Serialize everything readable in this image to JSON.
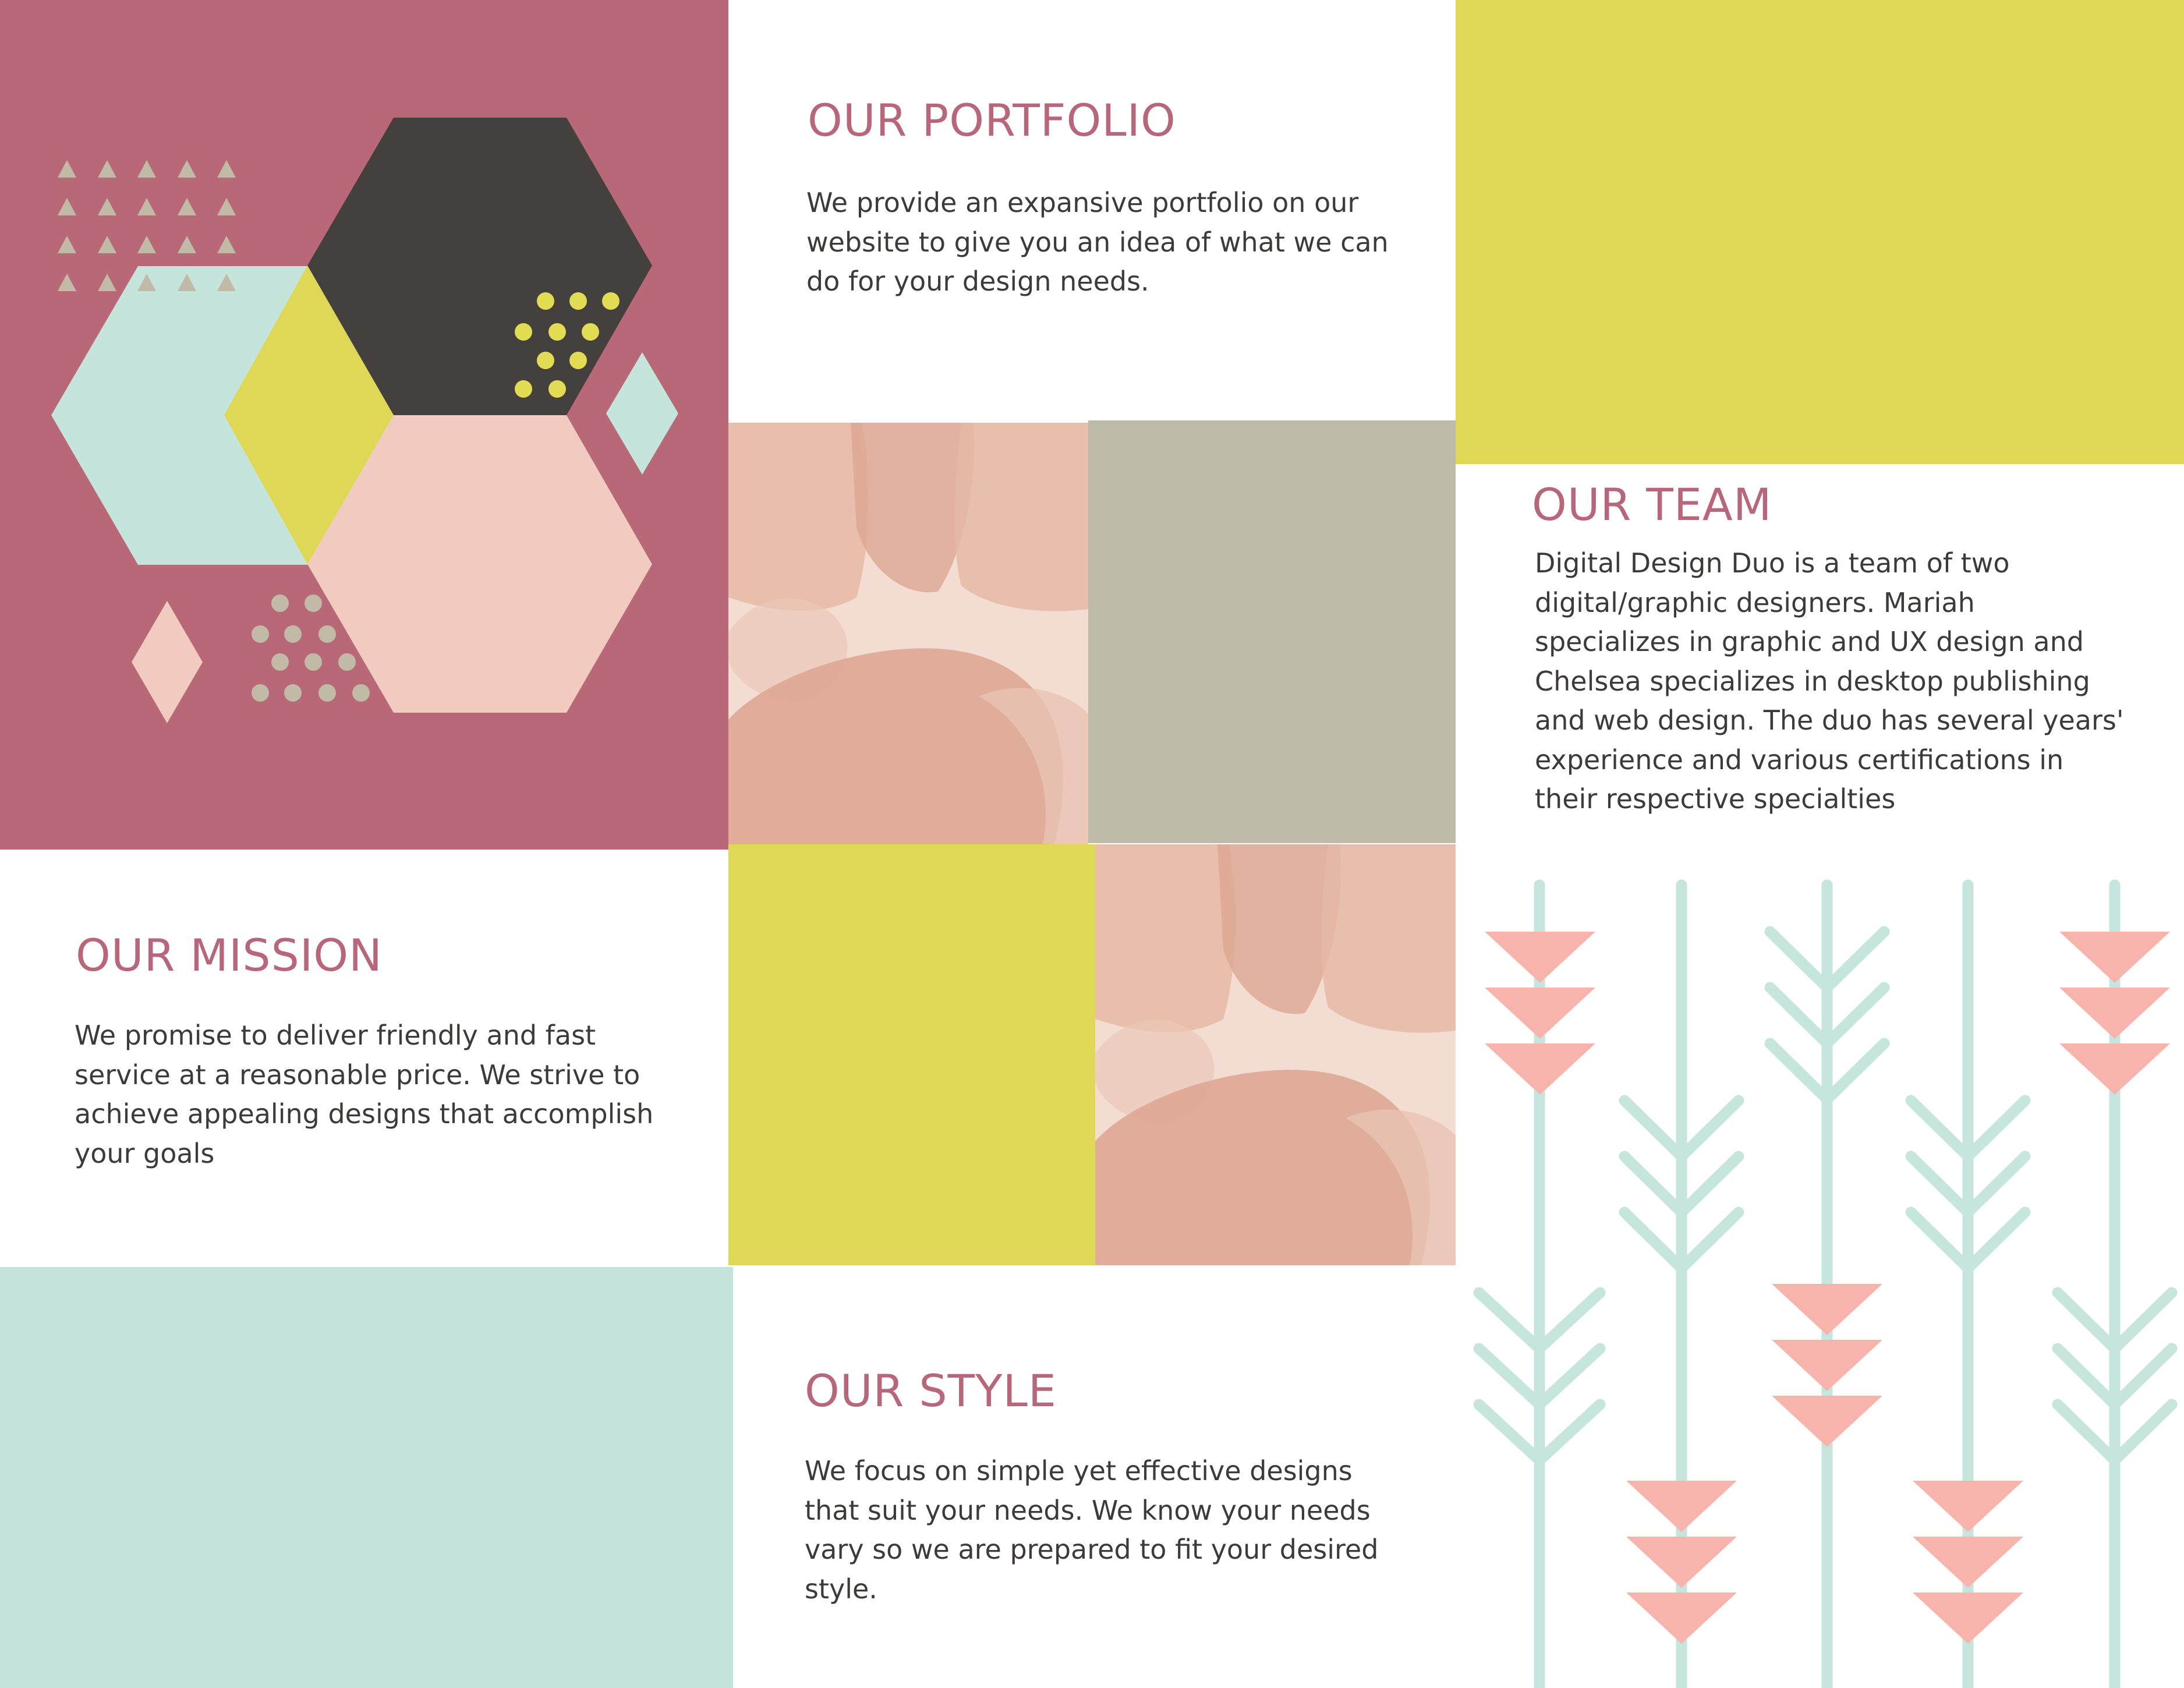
{
  "colors": {
    "rose": "#b86877",
    "lime": "#dfd856",
    "mint": "#c5e5dc",
    "charcoal": "#43403d",
    "blush": "#f1cbbf",
    "taupe": "#bebba8",
    "dot_yellow": "#e2dc55",
    "dot_gray": "#c1baa6",
    "arrow_pink": "#f7b3ac",
    "arrow_mint": "#c6e6dd",
    "heading": "#b8667a",
    "text": "#3d3a39"
  },
  "portfolio": {
    "title": "OUR PORTFOLIO",
    "lines": [
      "We provide an expansive portfolio on our",
      "website to give you an idea of what we can",
      "do for your design needs."
    ]
  },
  "team": {
    "title": "OUR TEAM",
    "lines": [
      "Digital Design Duo is a team of two",
      "digital/graphic designers. Mariah",
      "specializes in graphic and UX design and",
      "Chelsea specializes in desktop publishing",
      "and web design. The duo has several years'",
      "experience and various certifications in",
      "their respective specialties"
    ]
  },
  "mission": {
    "title": "OUR MISSION",
    "lines": [
      "We promise to deliver friendly and fast",
      "service at a reasonable price. We strive to",
      "achieve appealing designs that accomplish",
      "your goals"
    ]
  },
  "style": {
    "title": "OUR STYLE",
    "lines": [
      "We focus on simple yet effective designs",
      "that suit your needs. We know your needs",
      "vary so we are prepared to fit your desired",
      "style."
    ]
  }
}
